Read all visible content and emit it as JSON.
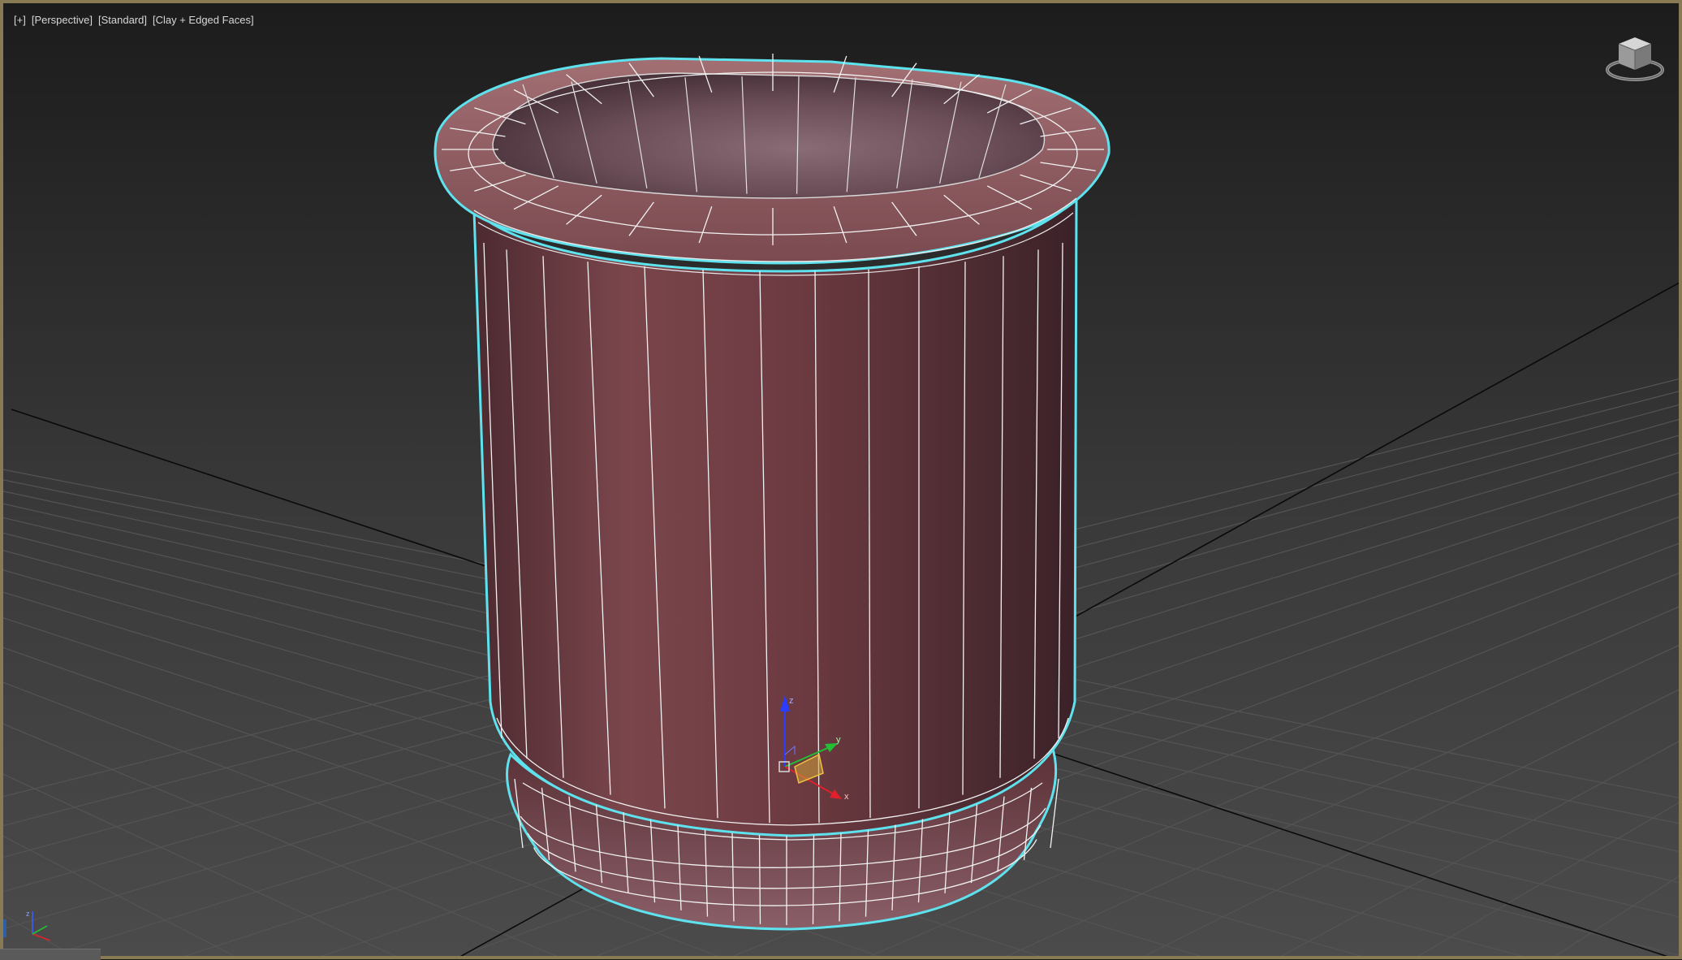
{
  "viewport": {
    "label_segments": [
      "[+]",
      "[Perspective]",
      "[Standard]",
      "[Clay + Edged Faces]"
    ],
    "active_border_color": "#877a54",
    "selection_outline_color": "#5ee3ee"
  },
  "scene": {
    "object": "pot",
    "object_color": "#6a3a3f"
  },
  "gizmo": {
    "x_label": "x",
    "y_label": "y",
    "z_label": "z"
  },
  "viewcube": {
    "icon": "viewcube-icon"
  },
  "corner_axis": {
    "icon": "axis-tripod-icon"
  }
}
